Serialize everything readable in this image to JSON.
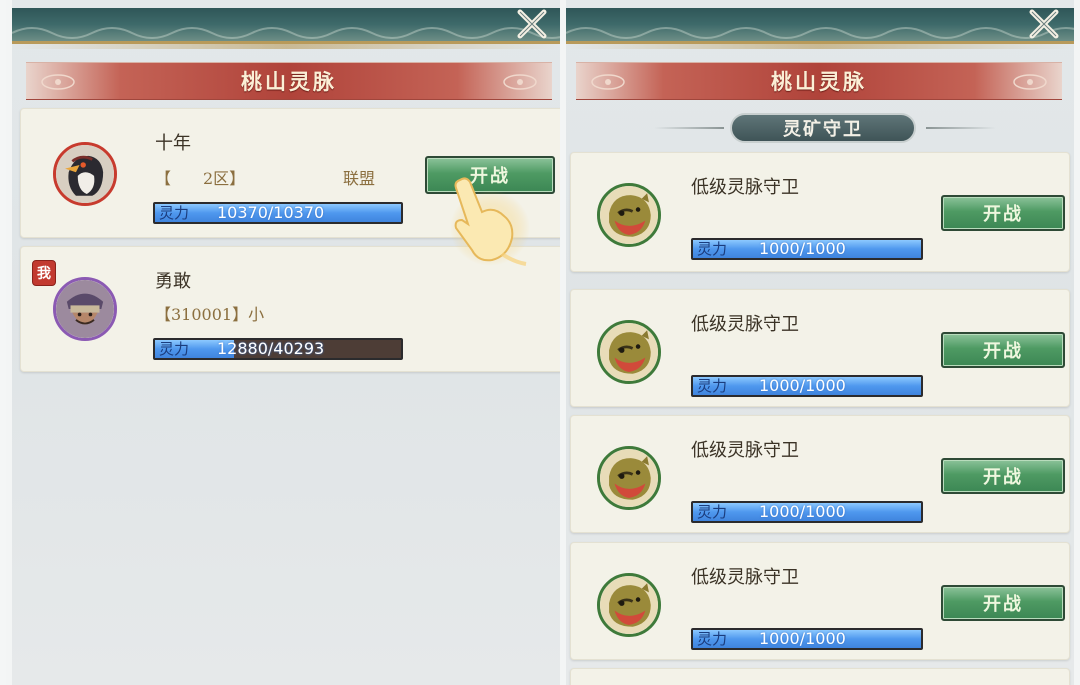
{
  "left_panel": {
    "title": "桃山灵脉",
    "cards": [
      {
        "name": "十年",
        "server": "【　　2区】",
        "alliance": "联盟",
        "power_label": "灵力",
        "power_value": "10370/10370",
        "power_fraction": 1.0,
        "fight_label": "开战"
      },
      {
        "name": "勇敢",
        "server": "【310001】小",
        "power_label": "灵力",
        "power_value": "12880/40293",
        "power_fraction": 0.32,
        "me_badge": "我"
      }
    ]
  },
  "right_panel": {
    "title": "桃山灵脉",
    "subtitle": "灵矿守卫",
    "guards": [
      {
        "name": "低级灵脉守卫",
        "power_label": "灵力",
        "power_value": "1000/1000",
        "power_fraction": 1.0,
        "fight_label": "开战"
      },
      {
        "name": "低级灵脉守卫",
        "power_label": "灵力",
        "power_value": "1000/1000",
        "power_fraction": 1.0,
        "fight_label": "开战"
      },
      {
        "name": "低级灵脉守卫",
        "power_label": "灵力",
        "power_value": "1000/1000",
        "power_fraction": 1.0,
        "fight_label": "开战"
      },
      {
        "name": "低级灵脉守卫",
        "power_label": "灵力",
        "power_value": "1000/1000",
        "power_fraction": 1.0,
        "fight_label": "开战"
      }
    ]
  },
  "icons": [
    "close-icon",
    "pointing-hand-icon",
    "eagle-avatar-icon",
    "warrior-avatar-icon",
    "beast-guard-avatar-icon"
  ],
  "colors": {
    "title_red": "#b0433a",
    "fight_green": "#4e9a63",
    "power_blue": "#4f98ee"
  }
}
